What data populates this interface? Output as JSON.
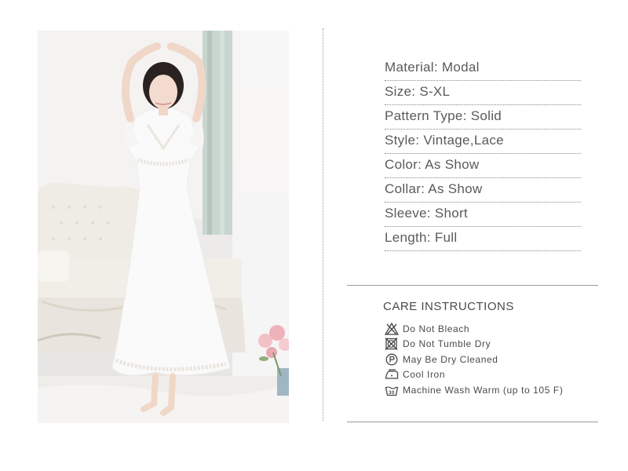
{
  "product_photo": {
    "alt": "woman in white lace nightgown",
    "subject": "woman in white lace short-sleeve long nightgown"
  },
  "specs": [
    {
      "label": "Material: Modal"
    },
    {
      "label": "Size: S-XL"
    },
    {
      "label": "Pattern Type: Solid"
    },
    {
      "label": "Style: Vintage,Lace"
    },
    {
      "label": "Color: As Show"
    },
    {
      "label": "Collar: As Show"
    },
    {
      "label": "Sleeve: Short"
    },
    {
      "label": "Length: Full"
    }
  ],
  "care": {
    "title": "CARE  INSTRUCTIONS",
    "items": [
      {
        "icon": "do-not-bleach-icon",
        "text": "Do  Not  Bleach"
      },
      {
        "icon": "do-not-tumble-dry-icon",
        "text": "Do  Not  Tumble  Dry"
      },
      {
        "icon": "dry-clean-p-icon",
        "text": "May  Be  Dry  Cleaned"
      },
      {
        "icon": "cool-iron-icon",
        "text": "Cool  Iron"
      },
      {
        "icon": "machine-wash-30-icon",
        "text": "Machine  Wash  Warm  (up  to  105  F)"
      }
    ]
  },
  "colors": {
    "text": "#555555",
    "divider": "#9a9a9a",
    "background": "#ffffff"
  }
}
